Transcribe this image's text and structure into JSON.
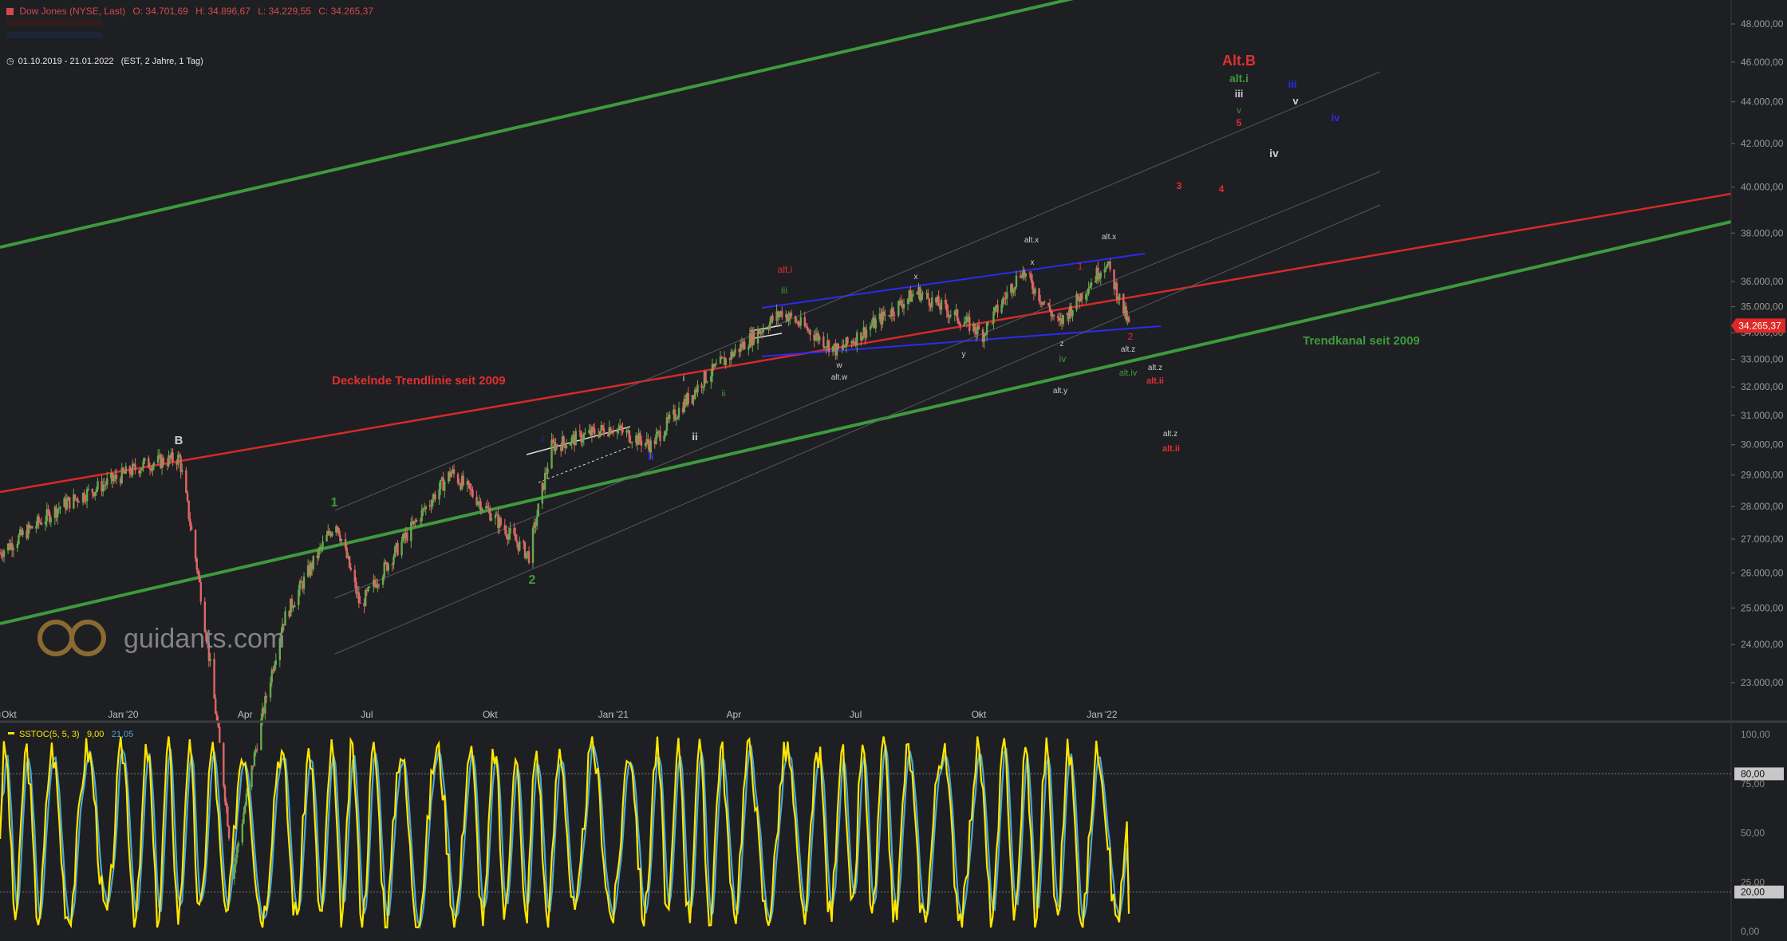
{
  "instrument": {
    "name": "Dow Jones (NYSE, Last)",
    "open": "O: 34.701,69",
    "high": "H: 34.896,67",
    "low": "L: 34.229,55",
    "close": "C: 34.265,37",
    "range": "01.10.2019 - 21.01.2022",
    "range_detail": "(EST, 2 Jahre, 1 Tag)",
    "last_price": "34.265,37"
  },
  "colors": {
    "background": "#1e1f22",
    "candle_up": "#6aa84f",
    "candle_down": "#e06666",
    "trendline_red": "#d42a2a",
    "trendline_green": "#3d9a3d",
    "channel_blue": "#2b2bf0",
    "stoch_k": "#ffe600",
    "stoch_d": "#4aa6d8",
    "price_badge": "#e02828"
  },
  "watermark": "guidants.com",
  "chart_data": [
    {
      "type": "candlestick",
      "title": "Dow Jones (NYSE, Last)",
      "x_start": "2019-10-01",
      "x_end": "2022-01-21",
      "ylim": [
        22400,
        49000
      ],
      "y_scale": "log",
      "x_tick_labels": [
        "Okt",
        "Jan '20",
        "Apr",
        "Jul",
        "Okt",
        "Jan '21",
        "Apr",
        "Jul",
        "Okt",
        "Jan '22"
      ],
      "y_tick_labels": [
        "23.000,00",
        "24.000,00",
        "25.000,00",
        "26.000,00",
        "27.000,00",
        "28.000,00",
        "29.000,00",
        "30.000,00",
        "31.000,00",
        "32.000,00",
        "33.000,00",
        "34.000,00",
        "35.000,00",
        "36.000,00",
        "38.000,00",
        "40.000,00",
        "42.000,00",
        "44.000,00",
        "46.000,00",
        "48.000,00"
      ],
      "approx_path": [
        {
          "date": "2019-10-01",
          "close": 26600
        },
        {
          "date": "2019-11-15",
          "close": 28000
        },
        {
          "date": "2020-01-17",
          "close": 29350
        },
        {
          "date": "2020-02-12",
          "close": 29550
        },
        {
          "date": "2020-02-28",
          "close": 25400
        },
        {
          "date": "2020-03-23",
          "close": 18600
        },
        {
          "date": "2020-04-29",
          "close": 24600
        },
        {
          "date": "2020-06-08",
          "close": 27550
        },
        {
          "date": "2020-06-26",
          "close": 25050
        },
        {
          "date": "2020-09-02",
          "close": 29100
        },
        {
          "date": "2020-10-30",
          "close": 26500
        },
        {
          "date": "2020-11-16",
          "close": 29950
        },
        {
          "date": "2020-12-31",
          "close": 30600
        },
        {
          "date": "2021-01-29",
          "close": 29980
        },
        {
          "date": "2021-03-10",
          "close": 32300
        },
        {
          "date": "2021-05-07",
          "close": 34800
        },
        {
          "date": "2021-06-18",
          "close": 33300
        },
        {
          "date": "2021-08-16",
          "close": 35600
        },
        {
          "date": "2021-10-04",
          "close": 33950
        },
        {
          "date": "2021-11-02",
          "close": 36450
        },
        {
          "date": "2021-11-30",
          "close": 34300
        },
        {
          "date": "2022-01-04",
          "close": 36800
        },
        {
          "date": "2022-01-21",
          "close": 34265.37
        }
      ],
      "annotations": {
        "trendline_red_label": "Deckelnde Trendlinie seit 2009",
        "trendline_green_label": "Trendkanal seit 2009",
        "wave_labels": [
          "B",
          "1",
          "2",
          "i",
          "ii",
          "i",
          "ii",
          "ii",
          "iii",
          "alt.i",
          "w",
          "alt.w",
          "x",
          "y",
          "z",
          "iv",
          "alt.y",
          "x",
          "alt.x",
          "alt.x",
          "1",
          "2",
          "alt.z",
          "alt.iv",
          "alt.z",
          "alt.ii",
          "alt.z",
          "alt.ii",
          "Alt.B",
          "alt.i",
          "iii",
          "v",
          "5",
          "iii",
          "v",
          "iv",
          "iv",
          "3",
          "4"
        ]
      }
    },
    {
      "type": "line",
      "title": "SSTOC(5, 5, 3)",
      "legend": [
        "SSTOC(5, 5, 3)",
        "9,00",
        "21,05"
      ],
      "ylim": [
        0,
        100
      ],
      "y_tick_labels": [
        "0,00",
        "20,00",
        "25,00",
        "50,00",
        "75,00",
        "80,00",
        "100,00"
      ],
      "reference_lines": [
        20,
        80
      ],
      "series": [
        {
          "name": "9,00",
          "color": "#ffe600",
          "last": 9.0
        },
        {
          "name": "21,05",
          "color": "#4aa6d8",
          "last": 21.05
        }
      ]
    }
  ]
}
